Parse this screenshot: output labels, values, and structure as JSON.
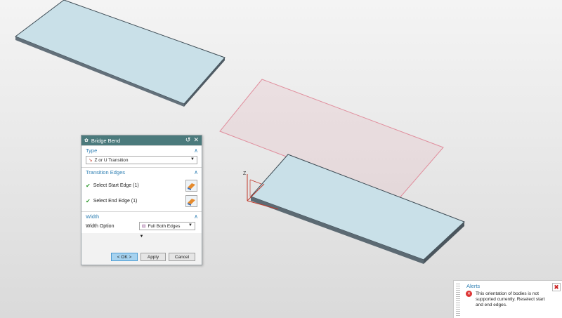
{
  "dialog": {
    "title": "Bridge Bend",
    "sections": {
      "type": {
        "header": "Type",
        "selected": "Z or U Transition"
      },
      "transition_edges": {
        "header": "Transition Edges",
        "start_edge": "Select Start Edge (1)",
        "end_edge": "Select End Edge (1)"
      },
      "width": {
        "header": "Width",
        "option_label": "Width Option",
        "option_value": "Full Both Edges"
      }
    },
    "buttons": {
      "ok": "< OK >",
      "apply": "Apply",
      "cancel": "Cancel"
    }
  },
  "alerts": {
    "header": "Alerts",
    "message": "This orientation of bodies is not supported currently. Reselect start and end edges."
  },
  "viewport": {
    "axis_label": "Z"
  },
  "colors": {
    "titlebar": "#4b7a7c",
    "section_header_text": "#2f7fb3",
    "plate_top": "#c9e0e8",
    "ghost_plane": "#e6a3ae"
  }
}
